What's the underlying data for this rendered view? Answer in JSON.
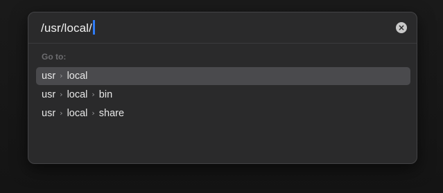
{
  "goto": {
    "path_value": "/usr/local/",
    "clear_icon": "×",
    "section_label": "Go to:",
    "separator": "›",
    "results": [
      {
        "segments": [
          "usr",
          "local"
        ],
        "selected": true
      },
      {
        "segments": [
          "usr",
          "local",
          "bin"
        ],
        "selected": false
      },
      {
        "segments": [
          "usr",
          "local",
          "share"
        ],
        "selected": false
      }
    ]
  }
}
